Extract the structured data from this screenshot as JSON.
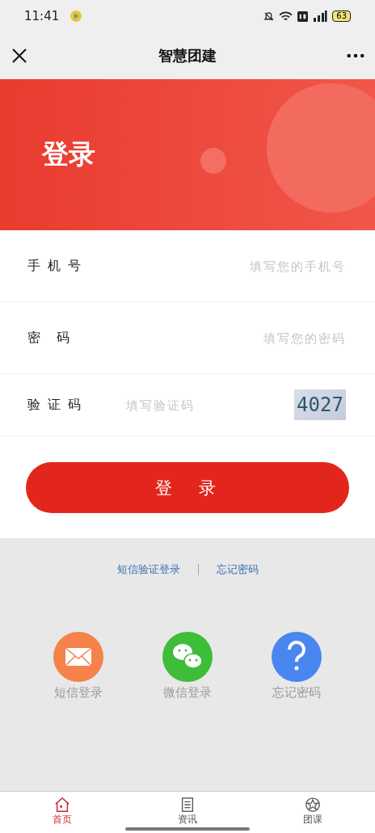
{
  "status_bar": {
    "time": "11:41",
    "battery": "63"
  },
  "nav": {
    "title": "智慧团建"
  },
  "banner": {
    "title": "登录"
  },
  "fields": [
    {
      "kind": "text",
      "label": "手 机 号",
      "placeholder": "填写您的手机号"
    },
    {
      "kind": "text",
      "label": "密　码",
      "placeholder": "填写您的密码"
    },
    {
      "kind": "captcha",
      "label": "验 证 码",
      "placeholder": "填写验证码",
      "captcha": "4027"
    }
  ],
  "login_button": "登　录",
  "links": [
    "短信验证登录",
    "忘记密码"
  ],
  "quick_logins": [
    {
      "kind": "sms",
      "label": "短信登录",
      "color": "#f5824a"
    },
    {
      "kind": "wechat",
      "label": "微信登录",
      "color": "#3ebd3a"
    },
    {
      "kind": "help",
      "label": "忘记密码",
      "color": "#4a86f0"
    }
  ],
  "tabs": [
    {
      "kind": "home",
      "label": "首页",
      "selected": true
    },
    {
      "kind": "news",
      "label": "资讯",
      "selected": false
    },
    {
      "kind": "course",
      "label": "团课",
      "selected": false
    }
  ]
}
